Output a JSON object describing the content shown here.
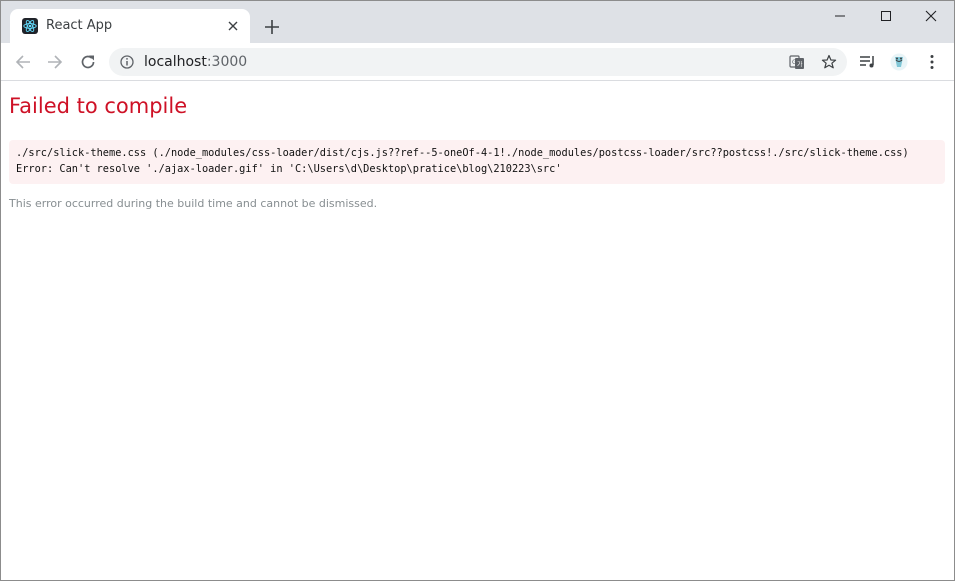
{
  "browser": {
    "tab": {
      "title": "React App",
      "favicon": "react-logo-icon"
    },
    "address_bar": {
      "host": "localhost",
      "port": ":3000"
    },
    "icons": {
      "back": "arrow-left-icon",
      "forward": "arrow-right-icon",
      "reload": "reload-icon",
      "info": "info-icon",
      "translate": "translate-icon",
      "bookmark": "star-icon",
      "media": "media-control-icon",
      "extension": "extension-icon",
      "menu": "kebab-menu-icon"
    },
    "colors": {
      "tabstrip": "#dee1e6",
      "omnibox": "#f1f3f4"
    }
  },
  "page": {
    "title": "Failed to compile",
    "error_lines": [
      "./src/slick-theme.css (./node_modules/css-loader/dist/cjs.js??ref--5-oneOf-4-1!./node_modules/postcss-loader/src??postcss!./src/slick-theme.css)",
      "Error: Can't resolve './ajax-loader.gif' in 'C:\\Users\\d\\Desktop\\pratice\\blog\\210223\\src'"
    ],
    "note": "This error occurred during the build time and cannot be dismissed.",
    "colors": {
      "title": "#ce1126",
      "error_background": "#fdf1f2",
      "note": "#878e91"
    }
  }
}
